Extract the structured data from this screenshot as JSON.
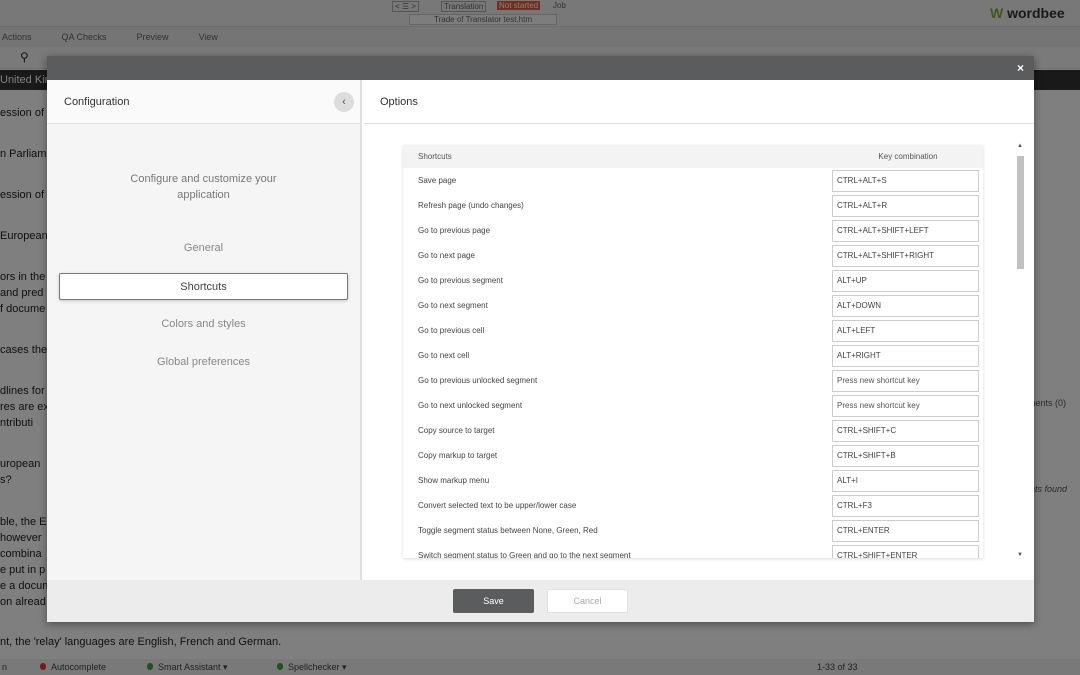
{
  "background": {
    "nav_buttons": "< ☰ >",
    "translation_label": "Translation",
    "status_badge": "Not started",
    "job_label": "Job",
    "document_tab": "Trade of Translator test.htm",
    "logo": "wordbee",
    "menu": [
      "Actions",
      "QA Checks",
      "Preview",
      "View"
    ],
    "language": "United Kin",
    "segments": [
      "ession of",
      "n Parliam",
      "ession of",
      "European",
      "ors in the",
      "and pred",
      "f docume",
      "cases the",
      "dlines for",
      "res are ex",
      "ntributi",
      "uropean",
      "s?",
      "ble, the E",
      "however",
      "combina",
      "e put in p",
      "e a docum",
      "on alread",
      "nt, the 'relay' languages are English, French and German."
    ],
    "comments": "ments (0)",
    "not_found": "nts found",
    "status_bar": {
      "first": "n",
      "autocomplete": "Autocomplete",
      "smart_assistant": "Smart Assistant",
      "spellchecker": "Spellchecker",
      "count": "1-33 of 33"
    }
  },
  "modal": {
    "close": "×",
    "left": {
      "title": "Configuration",
      "intro": "Configure and customize your application",
      "nav": [
        "General",
        "Shortcuts",
        "Colors and styles",
        "Global preferences"
      ],
      "active": 1
    },
    "right": {
      "title": "Options"
    },
    "table": {
      "headers": [
        "Shortcuts",
        "Key combination"
      ],
      "placeholder": "Press new shortcut key",
      "rows": [
        {
          "label": "Save page",
          "key": "CTRL+ALT+S"
        },
        {
          "label": "Refresh page (undo changes)",
          "key": "CTRL+ALT+R"
        },
        {
          "label": "Go to previous page",
          "key": "CTRL+ALT+SHIFT+LEFT"
        },
        {
          "label": "Go to next page",
          "key": "CTRL+ALT+SHIFT+RIGHT"
        },
        {
          "label": "Go to previous segment",
          "key": "ALT+UP"
        },
        {
          "label": "Go to next segment",
          "key": "ALT+DOWN"
        },
        {
          "label": "Go to previous cell",
          "key": "ALT+LEFT"
        },
        {
          "label": "Go to next cell",
          "key": "ALT+RIGHT"
        },
        {
          "label": "Go to previous unlocked segment",
          "key": ""
        },
        {
          "label": "Go to next unlocked segment",
          "key": ""
        },
        {
          "label": "Copy source to target",
          "key": "CTRL+SHIFT+C"
        },
        {
          "label": "Copy markup to target",
          "key": "CTRL+SHIFT+B"
        },
        {
          "label": "Show markup menu",
          "key": "ALT+I"
        },
        {
          "label": "Convert selected text to be upper/lower case",
          "key": "CTRL+F3"
        },
        {
          "label": "Toggle segment status between None, Green, Red",
          "key": "CTRL+ENTER"
        },
        {
          "label": "Switch segment status to Green and go to the next segment",
          "key": "CTRL+SHIFT+ENTER"
        }
      ]
    },
    "footer": {
      "save": "Save",
      "cancel": "Cancel"
    }
  }
}
